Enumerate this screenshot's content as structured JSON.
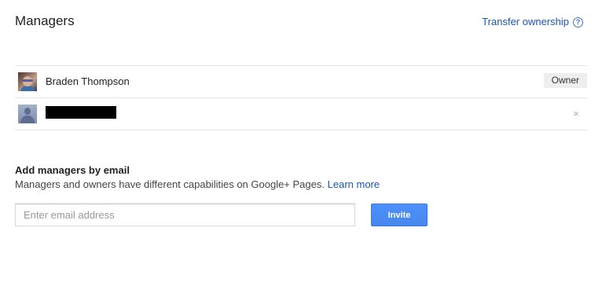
{
  "header": {
    "title": "Managers",
    "transfer_link": "Transfer ownership",
    "help_icon": "help-circle-icon"
  },
  "managers": [
    {
      "name": "Braden Thompson",
      "avatar": "profile-photo",
      "badge": "Owner"
    },
    {
      "name": "",
      "name_redacted": true,
      "avatar": "default-avatar-icon",
      "remove_icon": "×"
    }
  ],
  "add_managers": {
    "title": "Add managers by email",
    "description": "Managers and owners have different capabilities on Google+ Pages.",
    "learn_more": "Learn more",
    "email_placeholder": "Enter email address",
    "invite_label": "Invite"
  },
  "colors": {
    "link": "#1a55b8",
    "primary_button": "#4d90fe",
    "divider": "#e8e8e8",
    "badge_bg": "#eeeeee"
  }
}
